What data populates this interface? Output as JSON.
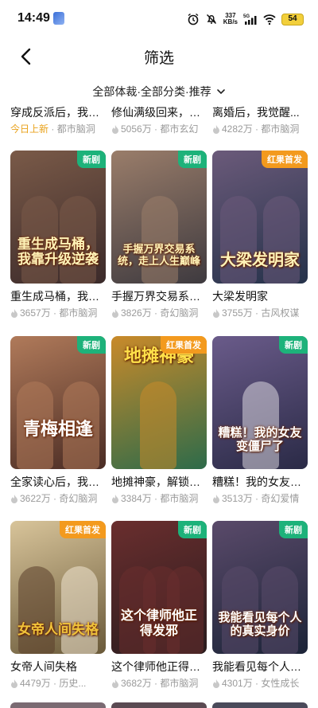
{
  "status": {
    "time": "14:49",
    "net_speed": "337",
    "net_unit": "KB/s",
    "network": "5G",
    "battery": "54"
  },
  "header": {
    "title": "筛选"
  },
  "filter": {
    "label": "全部体裁·全部分类·推荐"
  },
  "top_row": [
    {
      "title": "穿成反派后，我靠...",
      "tag": "今日上新",
      "genre": "都市脑洞"
    },
    {
      "title": "修仙满级回来，我...",
      "views": "5056万",
      "genre": "都市玄幻"
    },
    {
      "title": "离婚后，我觉醒...",
      "views": "4282万",
      "genre": "都市脑洞"
    }
  ],
  "rows": [
    [
      {
        "title": "重生成马桶，我靠...",
        "badge": "新剧",
        "cover_text": "重生成马桶，我靠升级逆袭",
        "views": "3657万",
        "genre": "都市脑洞",
        "colors": [
          "#3b2a2a",
          "#7a5a48"
        ]
      },
      {
        "title": "手握万界交易系统...",
        "badge": "新剧",
        "cover_text": "手握万界交易系统，走上人生巅峰",
        "views": "3826万",
        "genre": "奇幻脑洞",
        "colors": [
          "#3e3a3f",
          "#9a7d6a"
        ]
      },
      {
        "title": "大梁发明家",
        "badge": "红果首发",
        "cover_text": "大梁发明家",
        "views": "3755万",
        "genre": "古风权谋",
        "colors": [
          "#25324a",
          "#6b5a7a"
        ]
      }
    ],
    [
      {
        "title": "全家读心后，我成...",
        "badge": "新剧",
        "cover_text": "青梅相逢",
        "views": "3622万",
        "genre": "奇幻脑洞",
        "colors": [
          "#4a2c24",
          "#b07a5a"
        ]
      },
      {
        "title": "地摊神豪，解锁万...",
        "badge": "红果首发",
        "cover_text": "地摊神豪",
        "views": "3384万",
        "genre": "都市脑洞",
        "colors": [
          "#2d6b4a",
          "#c98a2a"
        ]
      },
      {
        "title": "糟糕！我的女友变...",
        "badge": "新剧",
        "cover_text": "糟糕！我的女友变僵尸了",
        "views": "3513万",
        "genre": "奇幻爱情",
        "colors": [
          "#2a2a46",
          "#6a5b8a"
        ]
      }
    ],
    [
      {
        "title": "女帝人间失格",
        "badge": "红果首发",
        "cover_text": "女帝人间失格",
        "views": "4479万",
        "genre": "历史...",
        "colors": [
          "#6a5a3a",
          "#d8c49a"
        ]
      },
      {
        "title": "这个律师他正得发...",
        "badge": "新剧",
        "cover_text": "这个律师他正得发邪",
        "views": "3682万",
        "genre": "都市脑洞",
        "colors": [
          "#2a1c1e",
          "#6a2e2e"
        ]
      },
      {
        "title": "我能看见每个人的...",
        "badge": "新剧",
        "cover_text": "我能看见每个人的真实身价",
        "views": "4301万",
        "genre": "女性成长",
        "colors": [
          "#1c2438",
          "#5a4a6a"
        ]
      }
    ]
  ],
  "icons": {
    "back": "chevron-left-icon",
    "filter": "chevron-down-icon",
    "views": "fire-icon"
  }
}
